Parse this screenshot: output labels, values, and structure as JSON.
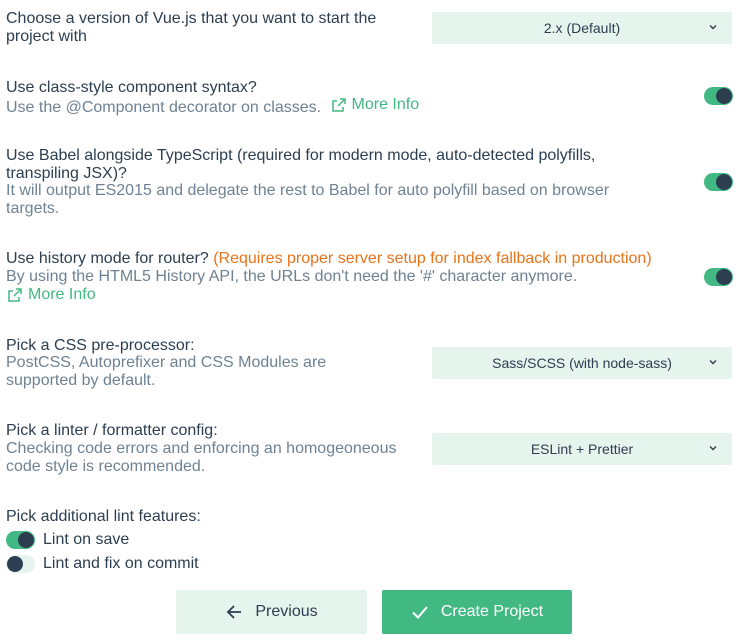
{
  "vue_version": {
    "title_line1": "Choose a version of Vue.js that you want to start the",
    "title_line2": "project with",
    "selected": "2.x (Default)"
  },
  "class_component": {
    "title": "Use class-style component syntax?",
    "desc": "Use the @Component decorator on classes.",
    "link": "More Info",
    "enabled": true
  },
  "babel": {
    "title_line1": "Use Babel alongside TypeScript (required for modern mode, auto-detected polyfills,",
    "title_line2": "transpiling JSX)?",
    "desc_line1": "It will output ES2015 and delegate the rest to Babel for auto polyfill based on browser",
    "desc_line2": "targets.",
    "enabled": true
  },
  "history_mode": {
    "title": "Use history mode for router?",
    "warning": "(Requires proper server setup for index fallback in production)",
    "desc": "By using the HTML5 History API, the URLs don't need the '#' character anymore.",
    "link": "More Info",
    "enabled": true
  },
  "css_preprocessor": {
    "title": "Pick a CSS pre-processor:",
    "desc_line1": "PostCSS, Autoprefixer and CSS Modules are",
    "desc_line2": "supported by default.",
    "selected": "Sass/SCSS (with node-sass)"
  },
  "linter": {
    "title": "Pick a linter / formatter config:",
    "desc_line1": "Checking code errors and enforcing an homogeoneous",
    "desc_line2": "code style is recommended.",
    "selected": "ESLint + Prettier"
  },
  "lint_features": {
    "title": "Pick additional lint features:",
    "items": [
      {
        "label": "Lint on save",
        "enabled": true
      },
      {
        "label": "Lint and fix on commit",
        "enabled": false
      }
    ]
  },
  "buttons": {
    "previous": "Previous",
    "create": "Create Project"
  },
  "colors": {
    "accent": "#42b983",
    "accent_light": "#e6f4ee",
    "text": "#2c3e50",
    "muted": "#6e8293",
    "warning": "#e8731a"
  }
}
